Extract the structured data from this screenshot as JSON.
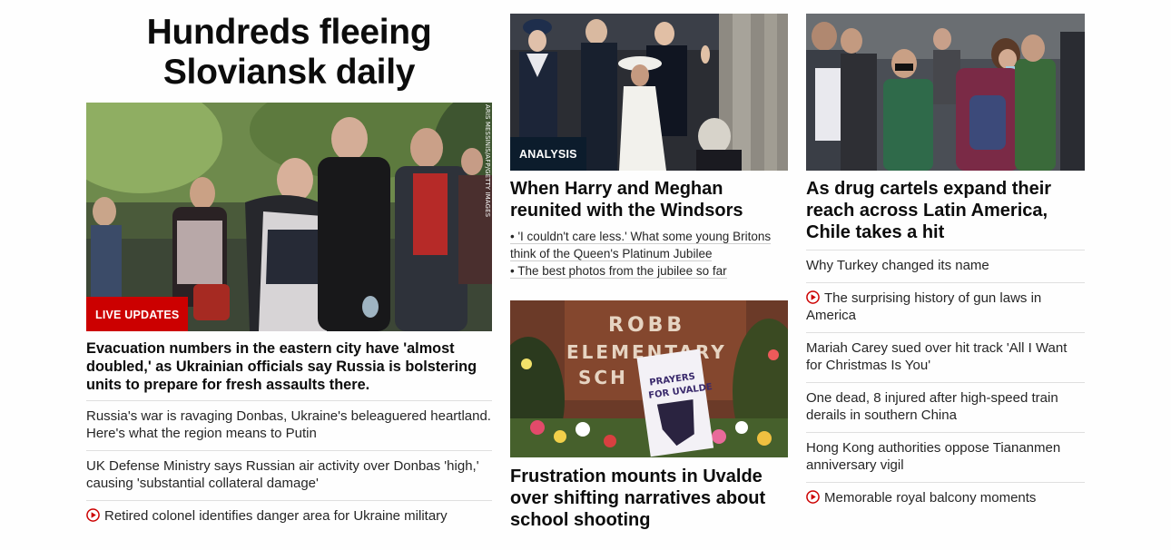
{
  "left": {
    "hero_title": "Hundreds fleeing Sloviansk daily",
    "badge": "LIVE UPDATES",
    "photo_credit": "ARIS MESSINIS/AFP/GETTY IMAGES",
    "lead_text": "Evacuation numbers in the eastern city have 'almost doubled,' as Ukrainian officials say Russia is bolstering units to prepare for fresh assaults there.",
    "links": [
      {
        "text": "Russia's war is ravaging Donbas, Ukraine's beleaguered heartland. Here's what the region means to Putin",
        "video": false
      },
      {
        "text": "UK Defense Ministry says Russian air activity over Donbas 'high,' causing 'substantial collateral damage'",
        "video": false
      },
      {
        "text": "Retired colonel identifies danger area for Ukraine military",
        "video": true
      }
    ]
  },
  "middle": {
    "story1": {
      "badge": "ANALYSIS",
      "headline": "When Harry and Meghan reunited with the Windsors",
      "sub_links": [
        "• 'I couldn't care less.' What some young Britons think of the Queen's Platinum Jubilee",
        "• The best photos from the jubilee so far"
      ]
    },
    "story2": {
      "headline": "Frustration mounts in Uvalde over shifting narratives about school shooting",
      "sign_text": [
        "ROBB",
        "ELEMENTARY",
        "SCH"
      ],
      "poster_text": [
        "PRAYERS",
        "FOR UVALDE"
      ]
    }
  },
  "right": {
    "headline": "As drug cartels expand their reach across Latin America, Chile takes a hit",
    "links": [
      {
        "text": "Why Turkey changed its name",
        "video": false
      },
      {
        "text": "The surprising history of gun laws in America",
        "video": true
      },
      {
        "text": "Mariah Carey sued over hit track 'All I Want for Christmas Is You'",
        "video": false
      },
      {
        "text": "One dead, 8 injured after high-speed train derails in southern China",
        "video": false
      },
      {
        "text": "Hong Kong authorities oppose Tiananmen anniversary vigil",
        "video": false
      },
      {
        "text": "Memorable royal balcony moments",
        "video": true
      }
    ]
  },
  "colors": {
    "live_red": "#cc0000",
    "analysis_navy": "#0c1c2c",
    "video_icon": "#cc0000"
  }
}
